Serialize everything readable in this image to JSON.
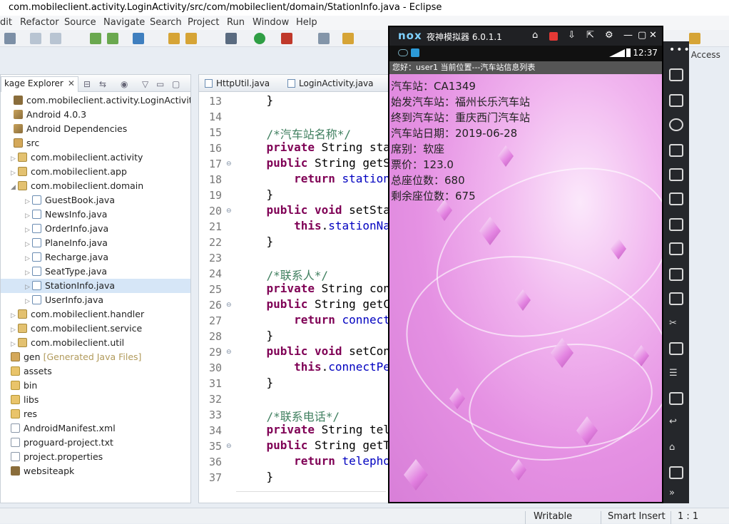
{
  "window": {
    "title": "com.mobileclient.activity.LoginActivity/src/com/mobileclient/domain/StationInfo.java - Eclipse"
  },
  "menu": [
    "dit",
    "Refactor",
    "Source",
    "Navigate",
    "Search",
    "Project",
    "Run",
    "Window",
    "Help"
  ],
  "quick_access": "k Access",
  "package_explorer": {
    "tab_label": "kage Explorer",
    "close": "✕",
    "items": [
      {
        "label": "com.mobileclient.activity.LoginActivity",
        "icon": "project-icon",
        "twisty": "",
        "note": ""
      },
      {
        "label": "Android 4.0.3",
        "icon": "library-icon",
        "twisty": "",
        "note": ""
      },
      {
        "label": "Android Dependencies",
        "icon": "library-icon",
        "twisty": "",
        "note": ""
      },
      {
        "label": "src",
        "icon": "source-folder-icon",
        "twisty": "",
        "note": ""
      },
      {
        "label": "com.mobileclient.activity",
        "icon": "package-icon",
        "twisty": "▷",
        "note": ""
      },
      {
        "label": "com.mobileclient.app",
        "icon": "package-icon",
        "twisty": "▷",
        "note": ""
      },
      {
        "label": "com.mobileclient.domain",
        "icon": "package-icon",
        "twisty": "◢",
        "note": ""
      },
      {
        "label": "GuestBook.java",
        "icon": "java-file-icon",
        "twisty": "▷",
        "note": ""
      },
      {
        "label": "NewsInfo.java",
        "icon": "java-file-icon",
        "twisty": "▷",
        "note": ""
      },
      {
        "label": "OrderInfo.java",
        "icon": "java-file-icon",
        "twisty": "▷",
        "note": ""
      },
      {
        "label": "PlaneInfo.java",
        "icon": "java-file-icon",
        "twisty": "▷",
        "note": ""
      },
      {
        "label": "Recharge.java",
        "icon": "java-file-icon",
        "twisty": "▷",
        "note": ""
      },
      {
        "label": "SeatType.java",
        "icon": "java-file-icon",
        "twisty": "▷",
        "note": ""
      },
      {
        "label": "StationInfo.java",
        "icon": "java-file-icon",
        "twisty": "▷",
        "note": ""
      },
      {
        "label": "UserInfo.java",
        "icon": "java-file-icon",
        "twisty": "▷",
        "note": ""
      },
      {
        "label": "com.mobileclient.handler",
        "icon": "package-icon",
        "twisty": "▷",
        "note": ""
      },
      {
        "label": "com.mobileclient.service",
        "icon": "package-icon",
        "twisty": "▷",
        "note": ""
      },
      {
        "label": "com.mobileclient.util",
        "icon": "package-icon",
        "twisty": "▷",
        "note": ""
      },
      {
        "label": "gen",
        "icon": "source-folder-icon",
        "twisty": "",
        "note": "[Generated Java Files]"
      },
      {
        "label": "assets",
        "icon": "folder-icon",
        "twisty": "",
        "note": ""
      },
      {
        "label": "bin",
        "icon": "folder-icon",
        "twisty": "",
        "note": ""
      },
      {
        "label": "libs",
        "icon": "folder-icon",
        "twisty": "",
        "note": ""
      },
      {
        "label": "res",
        "icon": "folder-icon",
        "twisty": "",
        "note": ""
      },
      {
        "label": "AndroidManifest.xml",
        "icon": "file-icon",
        "twisty": "",
        "note": ""
      },
      {
        "label": "proguard-project.txt",
        "icon": "file-icon",
        "twisty": "",
        "note": ""
      },
      {
        "label": "project.properties",
        "icon": "file-icon",
        "twisty": "",
        "note": ""
      },
      {
        "label": "websiteapk",
        "icon": "project-icon",
        "twisty": "",
        "note": ""
      }
    ]
  },
  "editor": {
    "tabs": [
      "HttpUtil.java",
      "LoginActivity.java"
    ],
    "line_numbers": [
      "13",
      "14",
      "15",
      "16",
      "17",
      "18",
      "19",
      "20",
      "21",
      "22",
      "23",
      "24",
      "25",
      "26",
      "27",
      "28",
      "29",
      "30",
      "31",
      "32",
      "33",
      "34",
      "35",
      "36",
      "37"
    ],
    "lines": [
      "    }",
      "",
      "    /*汽车站名称*/",
      "    private String sta",
      "    public String getS",
      "        return station",
      "    }",
      "    public void setSta",
      "        this.stationNa",
      "    }",
      "",
      "    /*联系人*/",
      "    private String con",
      "    public String getC",
      "        return connect",
      "    }",
      "    public void setCon",
      "        this.connectPe",
      "    }",
      "",
      "    /*联系电话*/",
      "    private String tel",
      "    public String getT",
      "        return telepho",
      "    }"
    ]
  },
  "emulator": {
    "brand": "nox",
    "name": "夜神模拟器 6.0.1.1",
    "time": "12:37",
    "app_header": "您好：user1  当前位置---汽车站信息列表",
    "fields": [
      "汽车站：CA1349",
      "始发汽车站：福州长乐汽车站",
      "终到汽车站：重庆西门汽车站",
      "汽车站日期：2019-06-28",
      "席别：软座",
      "票价：123.0",
      "总座位数：680",
      "剩余座位数：675"
    ]
  },
  "status": {
    "writable": "Writable",
    "insert_mode": "Smart Insert",
    "position": "1 : 1"
  }
}
